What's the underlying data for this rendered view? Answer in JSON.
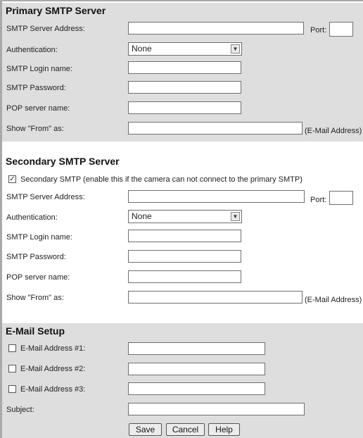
{
  "primary": {
    "title": "Primary SMTP Server",
    "server_address_label": "SMTP Server Address:",
    "port_label": "Port:",
    "auth_label": "Authentication:",
    "auth_value": "None",
    "login_label": "SMTP Login name:",
    "password_label": "SMTP Password:",
    "pop_label": "POP server name:",
    "from_label": "Show \"From\" as:",
    "from_hint": "(E-Mail Address)"
  },
  "secondary": {
    "title": "Secondary SMTP Server",
    "enable_label": "Secondary SMTP (enable this if the camera can not connect to the primary SMTP)",
    "enable_checked": true,
    "server_address_label": "SMTP Server Address:",
    "port_label": "Port:",
    "auth_label": "Authentication:",
    "auth_value": "None",
    "login_label": "SMTP Login name:",
    "password_label": "SMTP Password:",
    "pop_label": "POP server name:",
    "from_label": "Show \"From\" as:",
    "from_hint": "(E-Mail Address)"
  },
  "email": {
    "title": "E-Mail Setup",
    "address1_label": "E-Mail Address #1:",
    "address2_label": "E-Mail Address #2:",
    "address3_label": "E-Mail Address #3:",
    "subject_label": "Subject:"
  },
  "buttons": {
    "save": "Save",
    "cancel": "Cancel",
    "help": "Help"
  },
  "icons": {
    "check": "✓",
    "dropdown": "chevron-down-icon"
  }
}
